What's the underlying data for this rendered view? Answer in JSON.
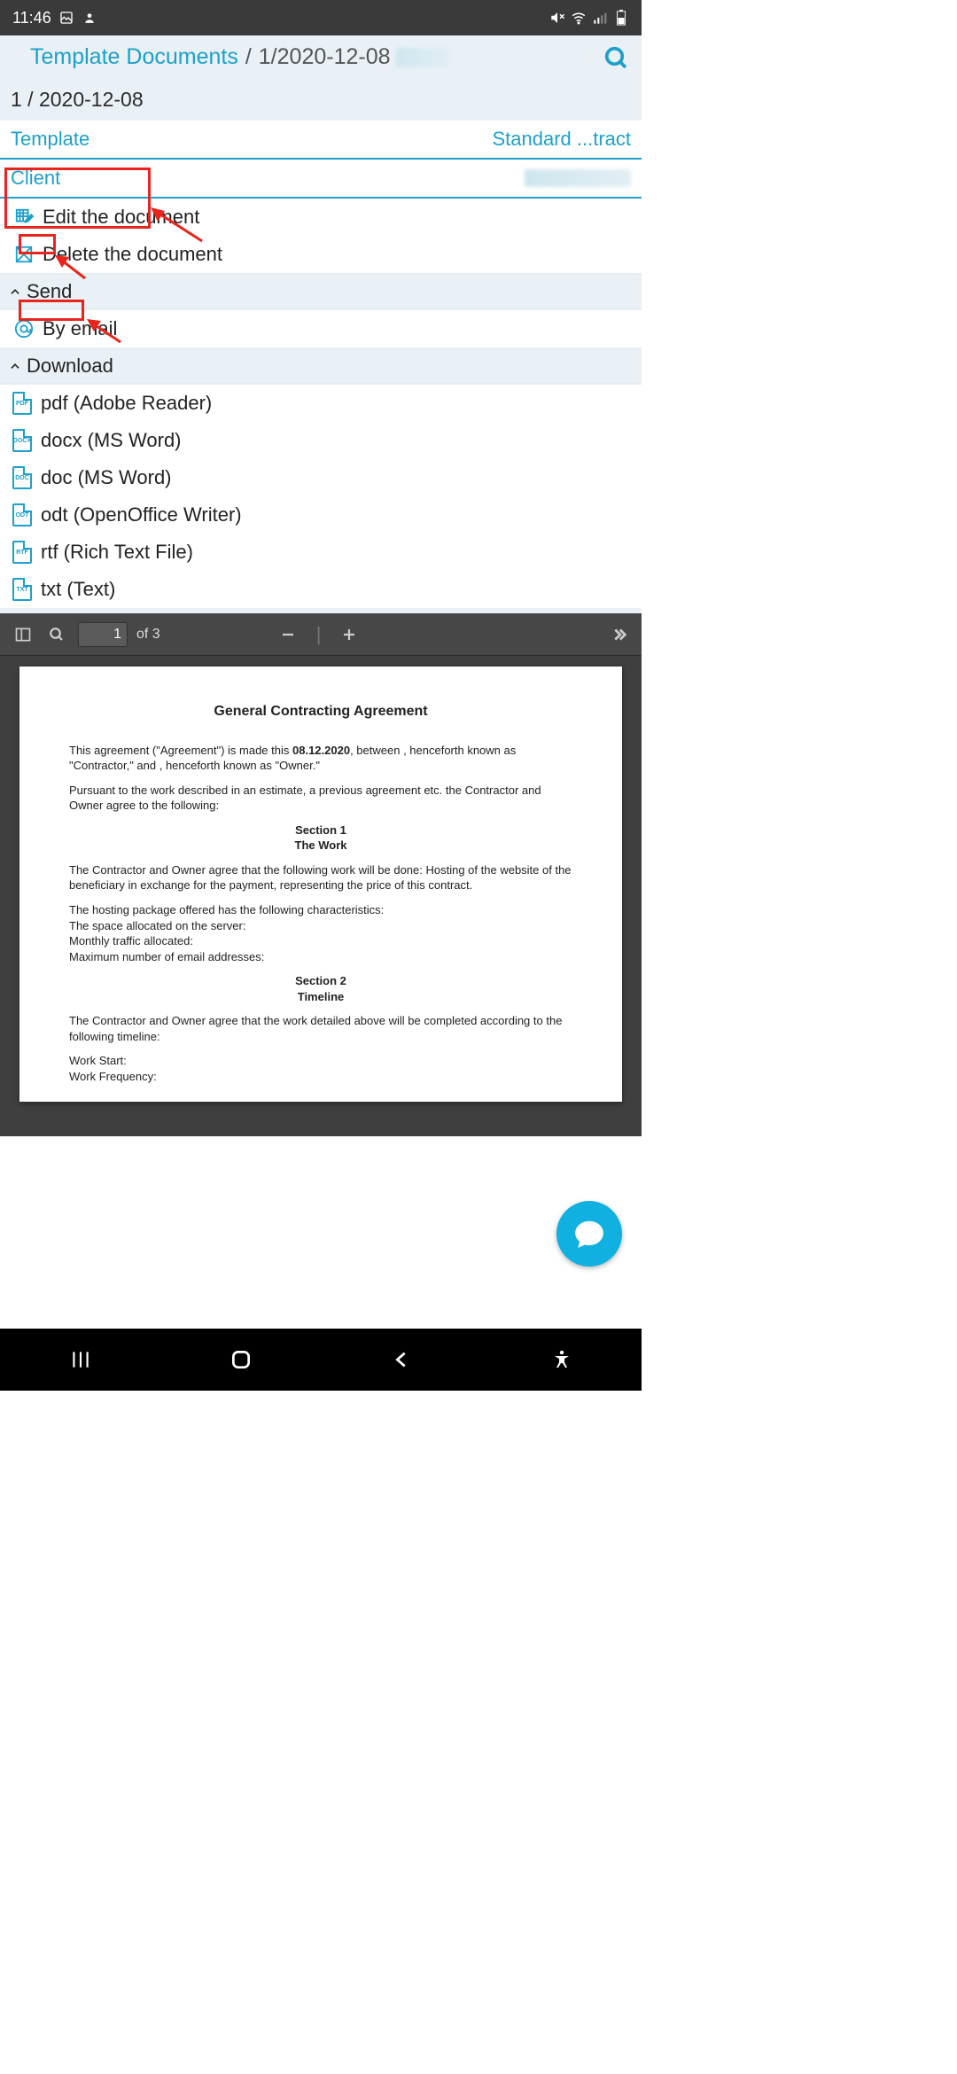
{
  "status_bar": {
    "time": "11:46"
  },
  "breadcrumb": {
    "home": "Template Documents",
    "sep": "/",
    "current": "1/2020-12-08"
  },
  "subheader": "1 / 2020-12-08",
  "fields": [
    {
      "label": "Template",
      "value": "Standard ...tract"
    },
    {
      "label": "Client",
      "value": ""
    }
  ],
  "actions": {
    "edit": "Edit the document",
    "delete": "Delete the document"
  },
  "sections": {
    "send": {
      "title": "Send",
      "by_email": "By email"
    },
    "download": {
      "title": "Download",
      "items": [
        {
          "ext": "PDF",
          "label": "pdf (Adobe Reader)"
        },
        {
          "ext": "DOCX",
          "label": "docx (MS Word)"
        },
        {
          "ext": "DOC",
          "label": "doc (MS Word)"
        },
        {
          "ext": "ODT",
          "label": "odt (OpenOffice Writer)"
        },
        {
          "ext": "RTF",
          "label": "rtf (Rich Text File)"
        },
        {
          "ext": "TXT",
          "label": "txt (Text)"
        }
      ]
    }
  },
  "viewer": {
    "page_input": "1",
    "of_label": "of 3"
  },
  "doc": {
    "title": "General Contracting Agreement",
    "date": "08.12.2020",
    "p1a": "This agreement (\"Agreement\") is made this ",
    "p1b": ", between , henceforth known as \"Contractor,\" and , henceforth known as \"Owner.\"",
    "p2": "Pursuant to the work described in an estimate, a previous agreement etc. the Contractor and Owner agree to the following:",
    "s1a": "Section 1",
    "s1b": "The Work",
    "p3": "The Contractor and Owner agree that the following work will be done: Hosting of the website of the beneficiary in exchange for the payment, representing the price of this contract.",
    "p4": "The hosting package offered has the following characteristics:",
    "p5": "The space allocated on the server:",
    "p6": "Monthly traffic allocated:",
    "p7": "Maximum number of email addresses:",
    "s2a": "Section 2",
    "s2b": "Timeline",
    "p8": "The Contractor and Owner agree that the work detailed above will be completed according to the following timeline:",
    "p9": "Work Start:",
    "p10": "Work Frequency:"
  }
}
